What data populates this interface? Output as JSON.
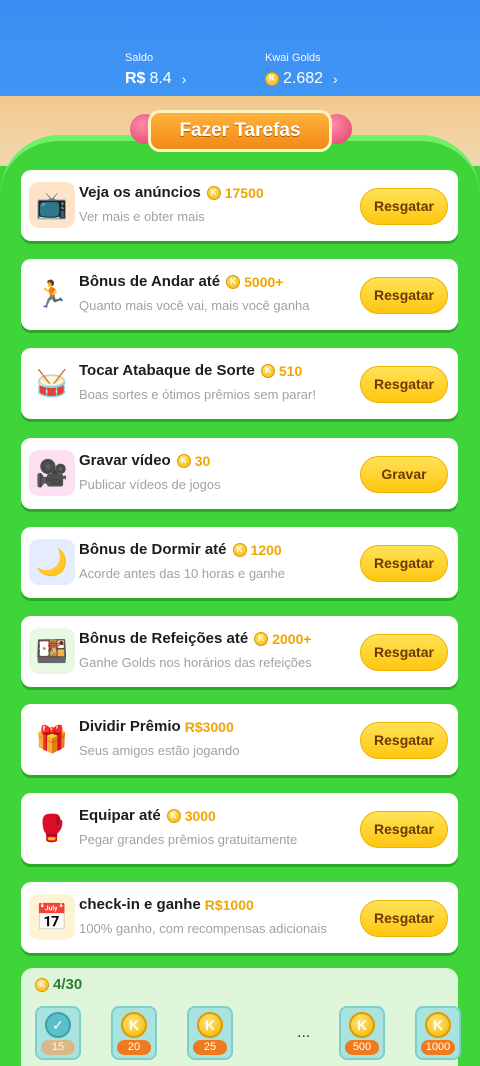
{
  "wallet": {
    "saldo_label": "Saldo",
    "saldo_currency": "R$",
    "saldo_value": "8.4",
    "golds_label": "Kwai Golds",
    "golds_value": "2.682",
    "chevron": "›"
  },
  "banner": {
    "title": "Fazer Tarefas"
  },
  "tasks": [
    {
      "title": "Veja os anúncios",
      "reward": "17500",
      "reward_type": "coin",
      "subtitle": "Ver mais e obter mais",
      "button": "Resgatar",
      "icon": "tv-icon"
    },
    {
      "title": "Bônus de Andar até",
      "reward": "5000+",
      "reward_type": "coin",
      "subtitle": "Quanto mais você vai, mais você ganha",
      "button": "Resgatar",
      "icon": "walking-person-icon"
    },
    {
      "title": "Tocar Atabaque de Sorte",
      "reward": "510",
      "reward_type": "coin",
      "subtitle": "Boas sortes e ótimos prêmios sem parar!",
      "button": "Resgatar",
      "icon": "drum-icon"
    },
    {
      "title": "Gravar vídeo",
      "reward": "30",
      "reward_type": "coin",
      "subtitle": "Publicar vídeos de jogos",
      "button": "Gravar",
      "icon": "video-camera-icon"
    },
    {
      "title": "Bônus de Dormir até",
      "reward": "1200",
      "reward_type": "coin",
      "subtitle": "Acorde antes das 10 horas e ganhe",
      "button": "Resgatar",
      "icon": "moon-icon"
    },
    {
      "title": "Bônus de Refeições até",
      "reward": "2000+",
      "reward_type": "coin",
      "subtitle": "Ganhe Golds nos horários das refeições",
      "button": "Resgatar",
      "icon": "meal-box-icon"
    },
    {
      "title": "Dividir Prêmio",
      "reward": "R$3000",
      "reward_type": "cash",
      "subtitle": "Seus amigos estão jogando",
      "button": "Resgatar",
      "icon": "gift-icon"
    },
    {
      "title": "Equipar até",
      "reward": "3000",
      "reward_type": "coin",
      "subtitle": "Pegar grandes prêmios gratuitamente",
      "button": "Resgatar",
      "icon": "boxing-gloves-icon"
    },
    {
      "title": "check-in e ganhe",
      "reward": "R$1000",
      "reward_type": "cash",
      "subtitle": "100% ganho, com recompensas adicionais",
      "button": "Resgatar",
      "icon": "calendar-icon"
    }
  ],
  "progress": {
    "count": "4/30",
    "milestones": [
      {
        "value": "15",
        "done": true
      },
      {
        "value": "20",
        "done": false
      },
      {
        "value": "25",
        "done": false
      },
      {
        "value": "500",
        "done": false
      },
      {
        "value": "1000",
        "done": false
      }
    ],
    "ellipsis": "..."
  }
}
